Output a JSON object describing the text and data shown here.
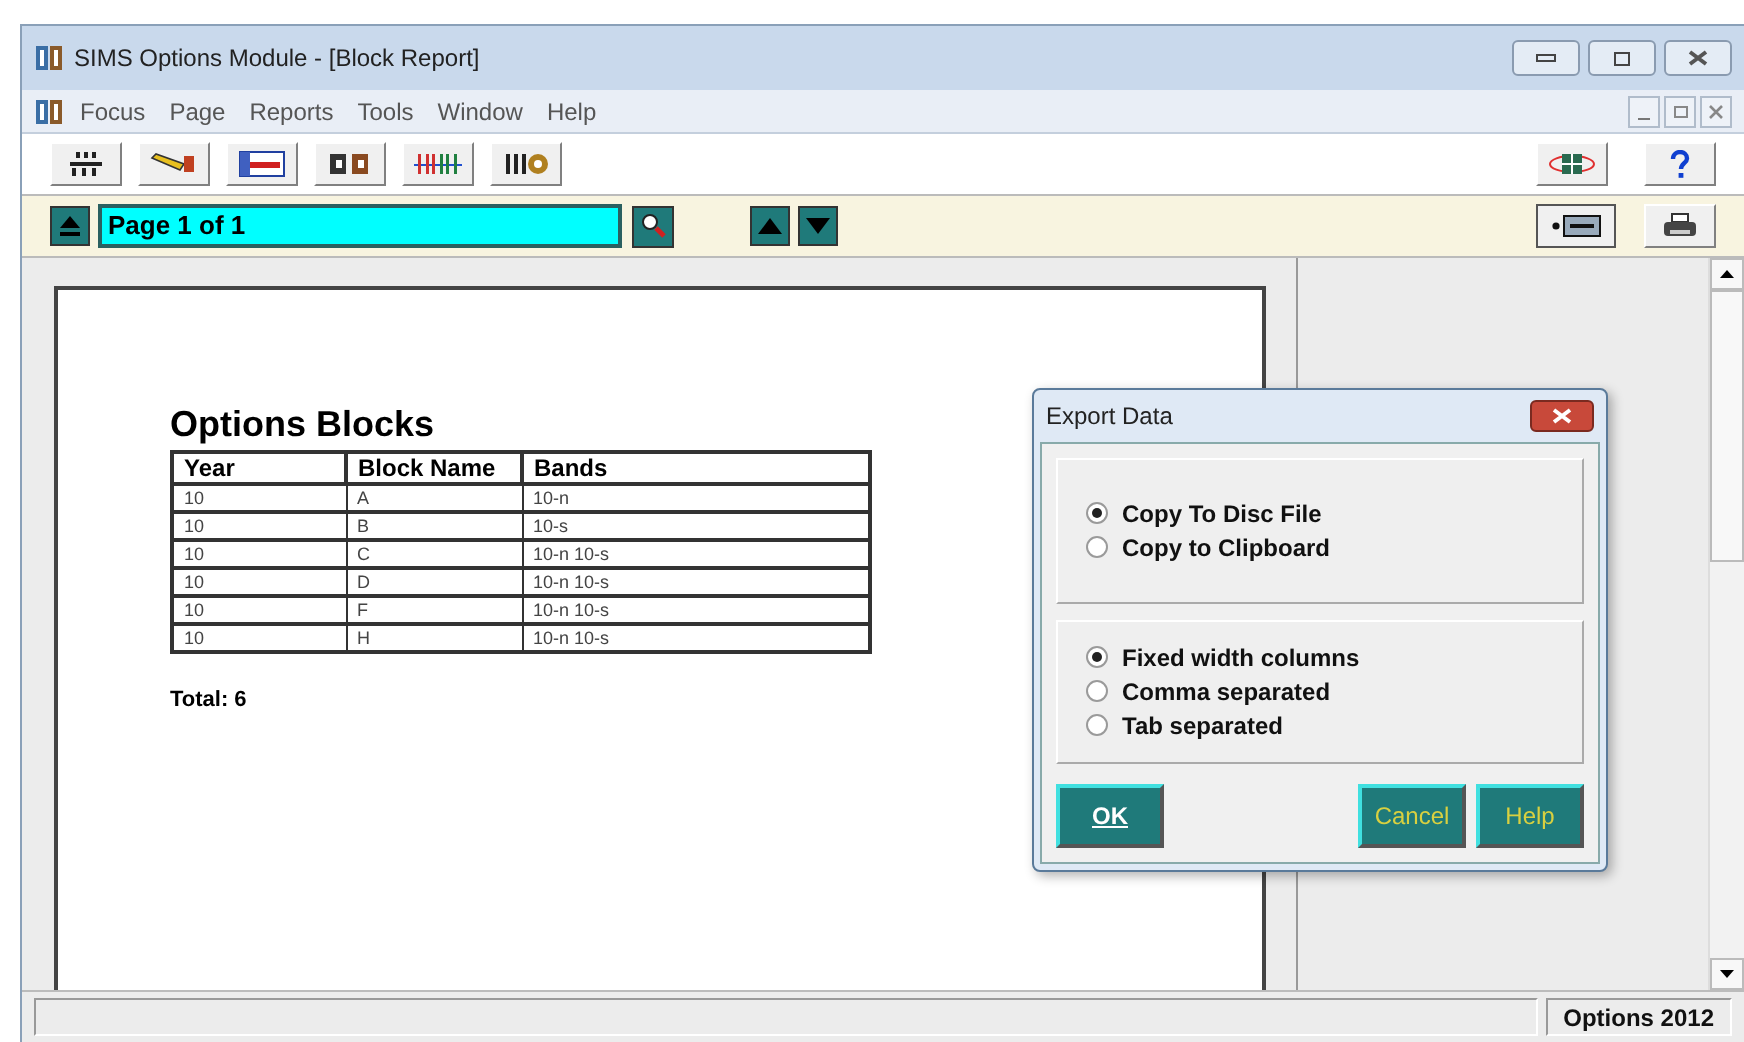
{
  "window": {
    "title": "SIMS Options Module - [Block Report]"
  },
  "menu": [
    "Focus",
    "Page",
    "Reports",
    "Tools",
    "Window",
    "Help"
  ],
  "navigation": {
    "page_field": "Page 1 of 1"
  },
  "report": {
    "title": "Options Blocks",
    "columns": [
      "Year",
      "Block Name",
      "Bands"
    ],
    "rows": [
      [
        "10",
        "A",
        "10-n"
      ],
      [
        "10",
        "B",
        "10-s"
      ],
      [
        "10",
        "C",
        "10-n 10-s"
      ],
      [
        "10",
        "D",
        "10-n 10-s"
      ],
      [
        "10",
        "F",
        "10-n 10-s"
      ],
      [
        "10",
        "H",
        "10-n 10-s"
      ]
    ],
    "total": "Total: 6"
  },
  "dialog": {
    "title": "Export Data",
    "destination": [
      {
        "label": "Copy To Disc File",
        "selected": true
      },
      {
        "label": "Copy to Clipboard",
        "selected": false
      }
    ],
    "format": [
      {
        "label": "Fixed width columns",
        "selected": true
      },
      {
        "label": "Comma separated",
        "selected": false
      },
      {
        "label": "Tab separated",
        "selected": false
      }
    ],
    "buttons": [
      {
        "label": "OK",
        "kind": "default"
      },
      {
        "label": "Cancel",
        "kind": "normal"
      },
      {
        "label": "Help",
        "kind": "normal"
      }
    ]
  },
  "status_bar": {
    "version": "Options 2012"
  }
}
